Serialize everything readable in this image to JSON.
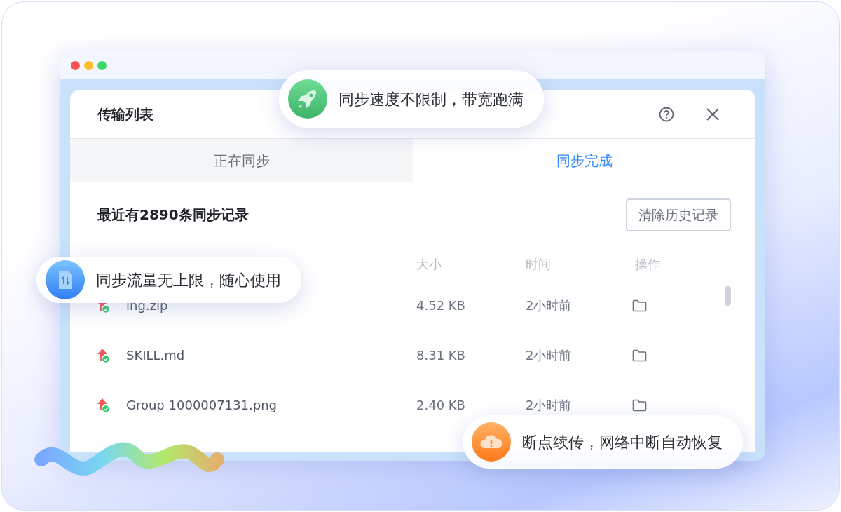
{
  "window": {
    "controls": [
      {
        "color": "#fc4f4f"
      },
      {
        "color": "#febc2e"
      },
      {
        "color": "#3fd76a"
      }
    ]
  },
  "panel": {
    "title": "传输列表",
    "tabs": [
      {
        "label": "正在同步",
        "selected": false
      },
      {
        "label": "同步完成",
        "selected": true
      }
    ],
    "summary": "最近有2890条同步记录",
    "clear_button": "清除历史记录",
    "columns": [
      "大小",
      "时间",
      "操作"
    ],
    "rows": [
      {
        "name": "ing.zip",
        "size": "4.52 KB",
        "time": "2小时前"
      },
      {
        "name": "SKILL.md",
        "size": "8.31 KB",
        "time": "2小时前"
      },
      {
        "name": "Group 1000007131.png",
        "size": "2.40 KB",
        "time": "2小时前"
      }
    ]
  },
  "callouts": [
    {
      "kind": "rocket",
      "text": "同步速度不限制，带宽跑满"
    },
    {
      "kind": "file",
      "text": "同步流量无上限，随心使用"
    },
    {
      "kind": "cloud",
      "text": "断点续传，网络中断自动恢复"
    }
  ]
}
